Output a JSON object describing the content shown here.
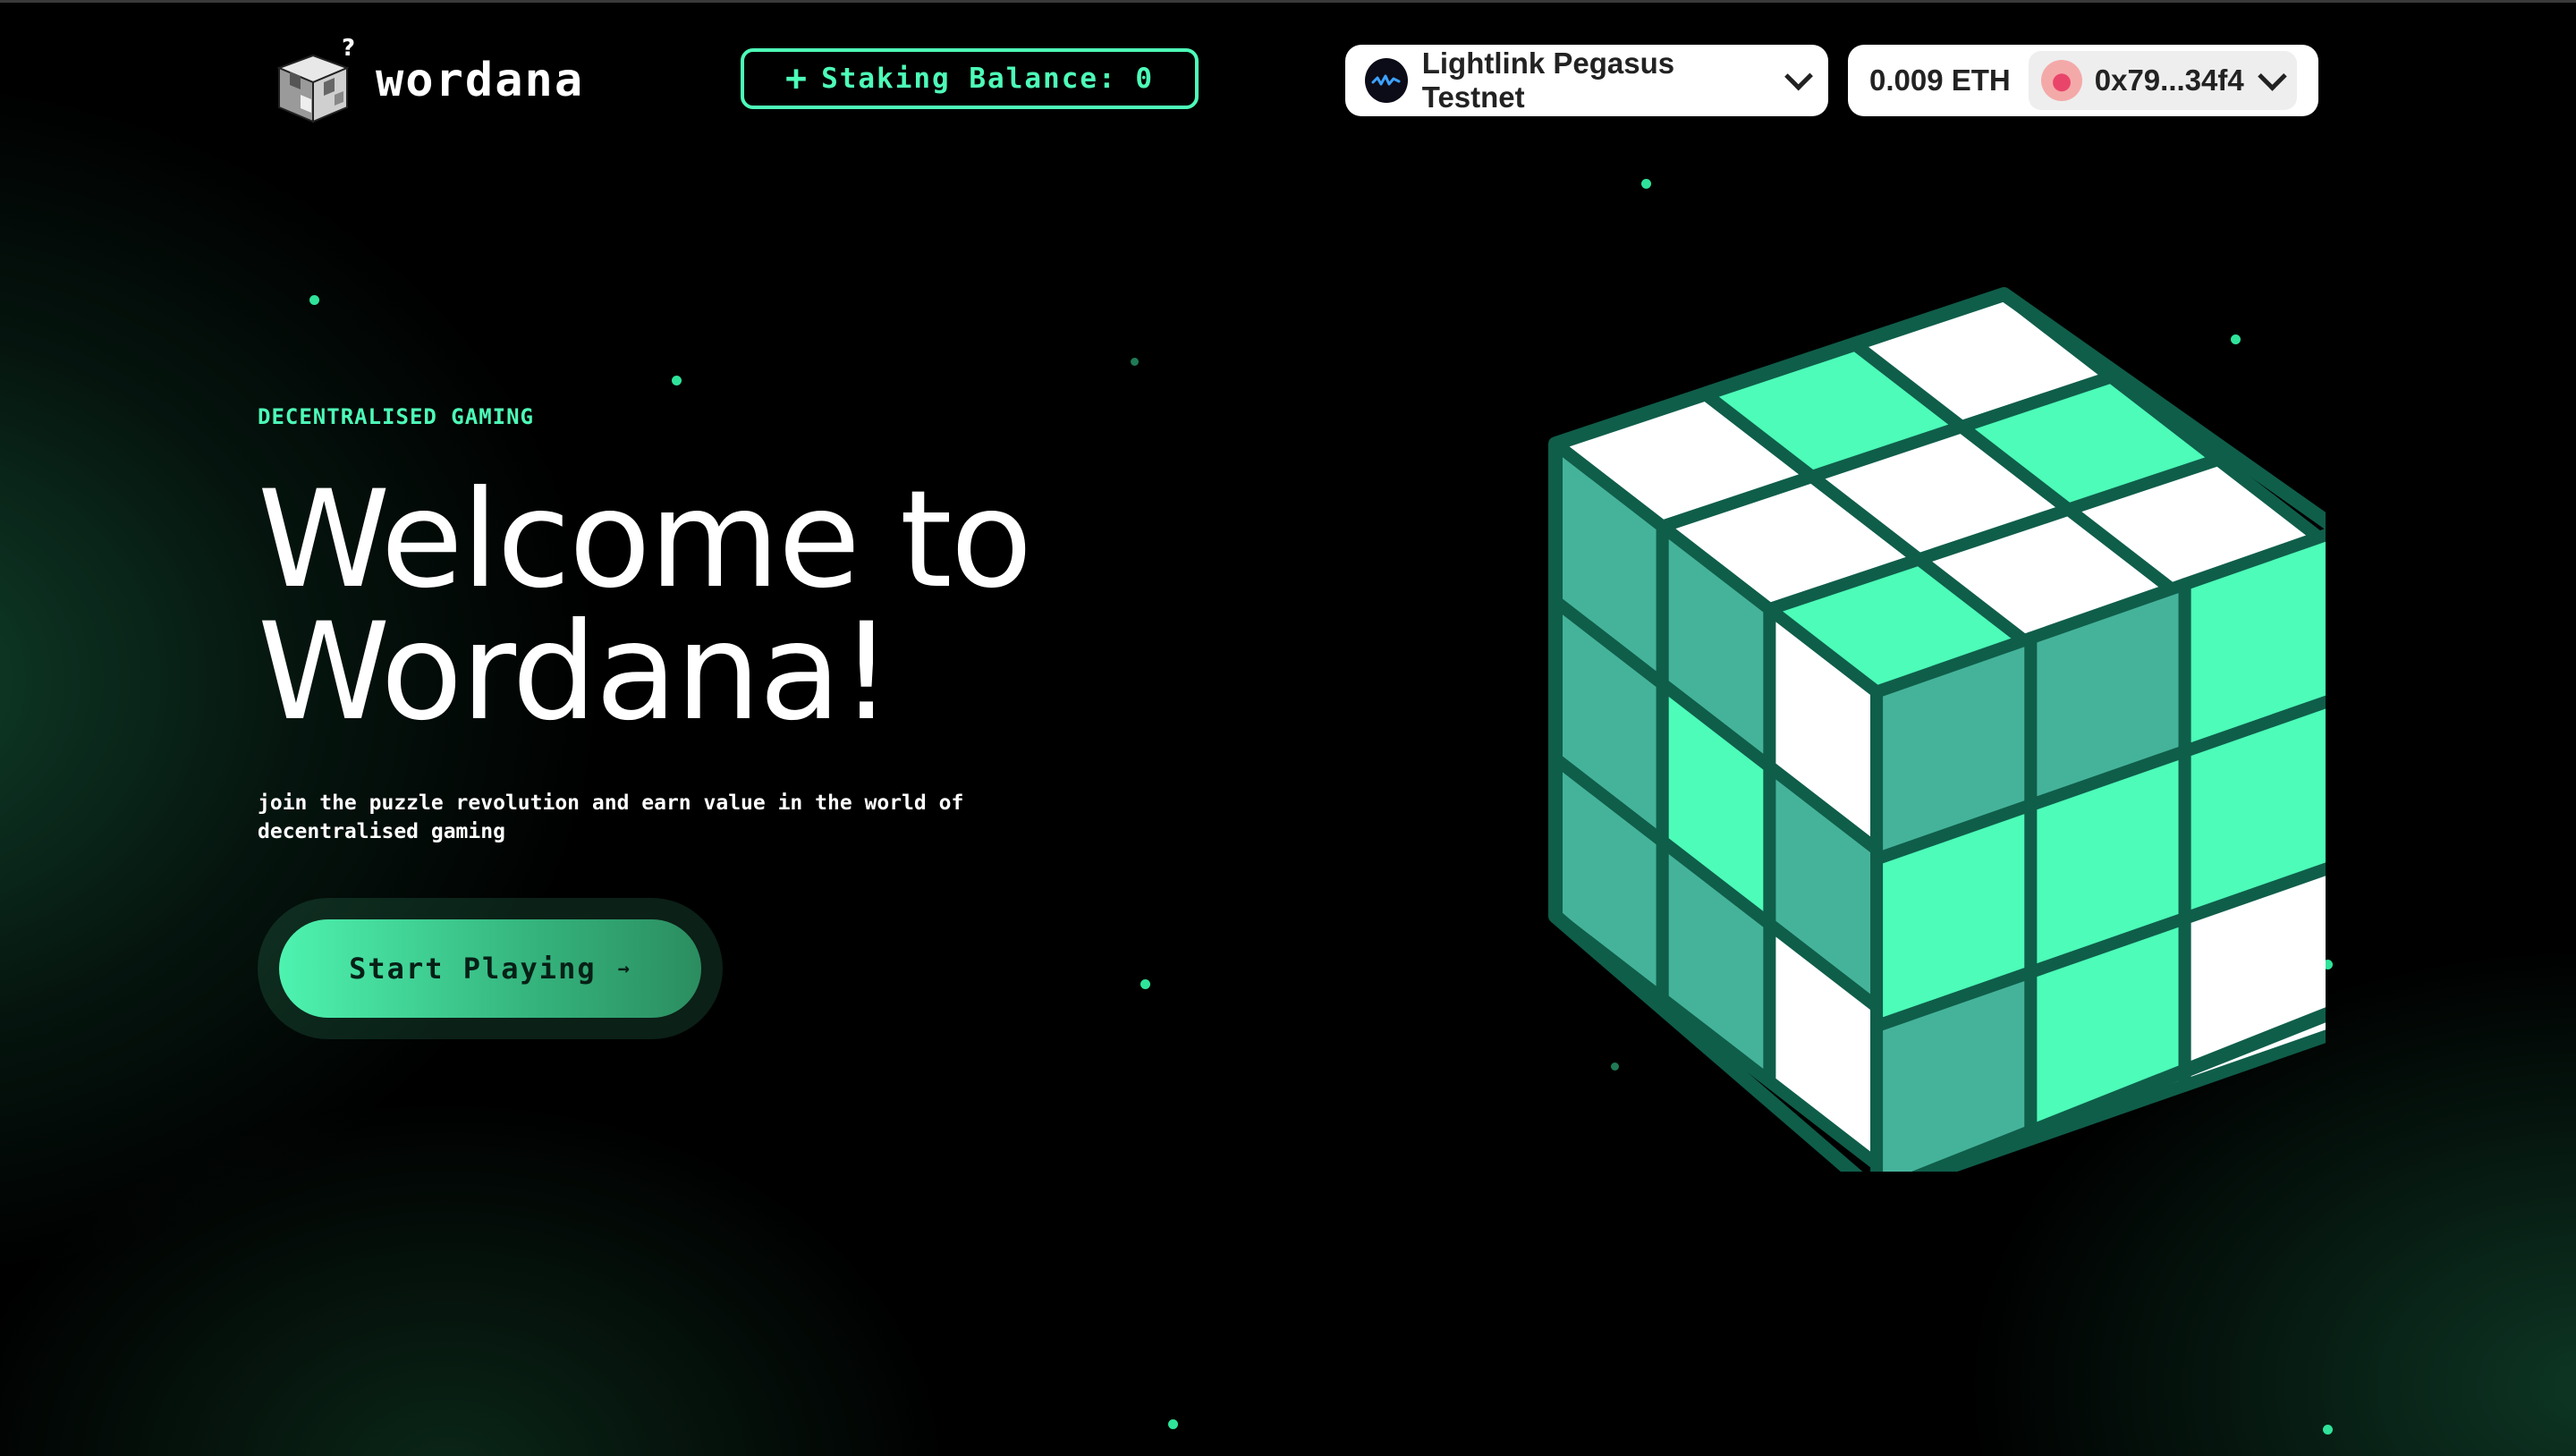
{
  "header": {
    "logo_text": "wordana",
    "staking_label": "Staking Balance: 0",
    "network_name": "Lightlink Pegasus Testnet",
    "balance": "0.009 ETH",
    "address": "0x79...34f4"
  },
  "hero": {
    "eyebrow": "DECENTRALISED GAMING",
    "title_line1": "Welcome to",
    "title_line2": "Wordana!",
    "subtitle": "join the puzzle revolution and earn value in the world of decentralised gaming",
    "cta_label": "Start Playing",
    "cta_arrow": "→"
  },
  "icons": [
    "logo-cube-icon",
    "plus-icon",
    "lightlink-icon",
    "chevron-down-icon",
    "avatar-icon",
    "arrow-right-icon"
  ],
  "colors": {
    "accent": "#4dfcb8",
    "cube_light": "#4dfcb8",
    "cube_mid": "#45b39a",
    "cube_edge": "#0f5e4a",
    "background": "#000000"
  }
}
